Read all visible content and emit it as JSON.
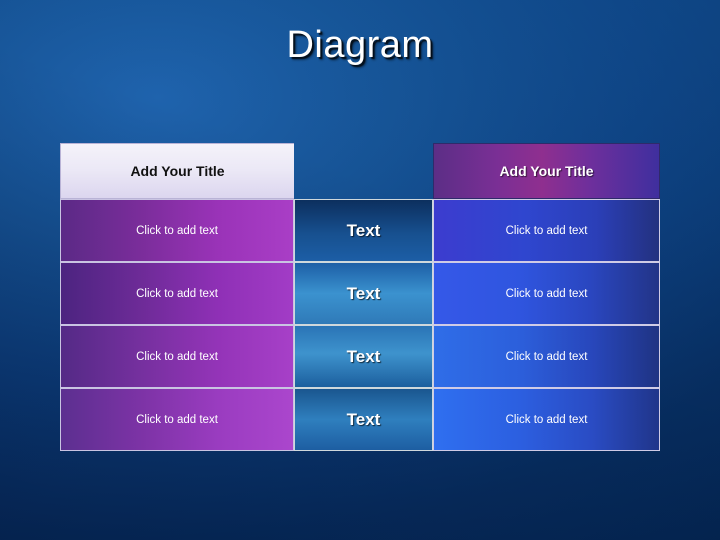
{
  "slide": {
    "title": "Diagram",
    "background_colors": {
      "top_left": "#1f63ad",
      "bottom_right": "#03224b"
    }
  },
  "diagram": {
    "header": {
      "left_label": "Add Your Title",
      "middle_label": "",
      "right_label": "Add Your Title"
    },
    "rows": [
      {
        "left": "Click to add text",
        "middle": "Text",
        "right": "Click to add text"
      },
      {
        "left": "Click to add text",
        "middle": "Text",
        "right": "Click to add text"
      },
      {
        "left": "Click to add text",
        "middle": "Text",
        "right": "Click to add text"
      },
      {
        "left": "Click to add text",
        "middle": "Text",
        "right": "Click to add text"
      }
    ]
  }
}
